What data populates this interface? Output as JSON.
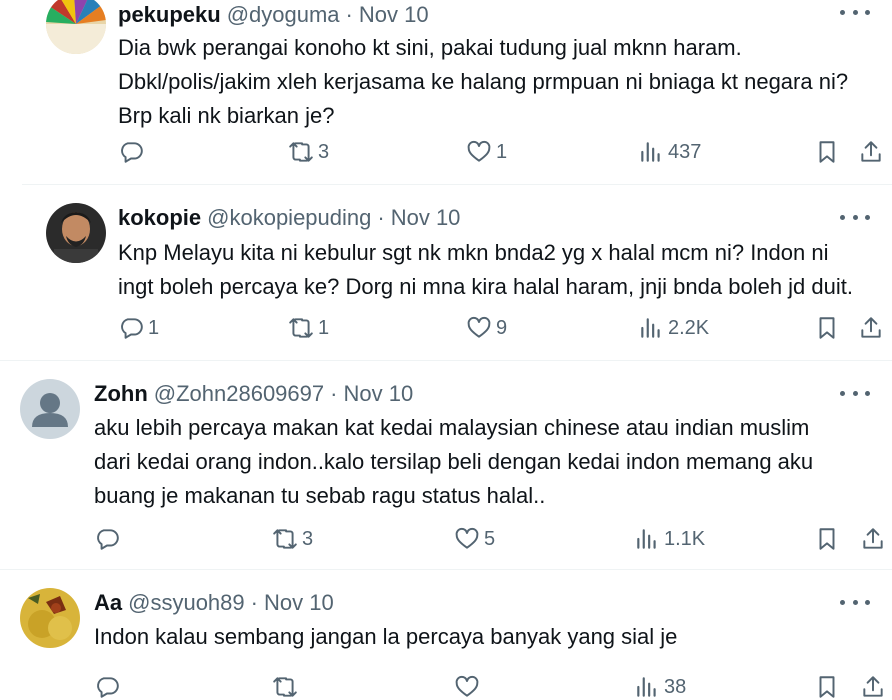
{
  "tweets": [
    {
      "name": "pekupeku",
      "handle": "@dyoguma",
      "sep": "·",
      "date": "Nov 10",
      "lines": [
        "Dia bwk perangai konoho kt sini, pakai tudung jual mknn haram.",
        "Dbkl/polis/jakim xleh kerjasama ke halang prmpuan ni bniaga kt negara ni?",
        "Brp kali nk biarkan je?"
      ],
      "replies": "",
      "reposts": "3",
      "likes": "1",
      "views": "437"
    },
    {
      "name": "kokopie",
      "handle": "@kokopiepuding",
      "sep": "·",
      "date": "Nov 10",
      "lines": [
        "Knp Melayu kita ni kebulur sgt nk mkn bnda2 yg x halal mcm ni? Indon ni",
        "ingt boleh percaya ke? Dorg ni mna kira halal haram, jnji bnda boleh jd duit."
      ],
      "replies": "1",
      "reposts": "1",
      "likes": "9",
      "views": "2.2K"
    },
    {
      "name": "Zohn",
      "handle": "@Zohn28609697",
      "sep": "·",
      "date": "Nov 10",
      "lines": [
        "aku lebih percaya makan kat kedai malaysian chinese atau indian muslim",
        "dari kedai orang indon..kalo tersilap beli dengan kedai indon memang aku",
        "buang je makanan tu sebab ragu status halal.."
      ],
      "replies": "",
      "reposts": "3",
      "likes": "5",
      "views": "1.1K"
    },
    {
      "name": "Aa",
      "handle": "@ssyuoh89",
      "sep": "·",
      "date": "Nov 10",
      "lines": [
        "Indon kalau sembang jangan la percaya banyak yang sial je"
      ],
      "replies": "",
      "reposts": "",
      "likes": "",
      "views": "38"
    }
  ],
  "icons": {
    "reply": "reply-icon",
    "repost": "repost-icon",
    "like": "heart-icon",
    "views": "views-icon",
    "bookmark": "bookmark-icon",
    "share": "share-icon",
    "more": "more-icon"
  },
  "colors": {
    "text": "#0f1419",
    "secondary": "#536471",
    "divider": "#eff3f4"
  }
}
